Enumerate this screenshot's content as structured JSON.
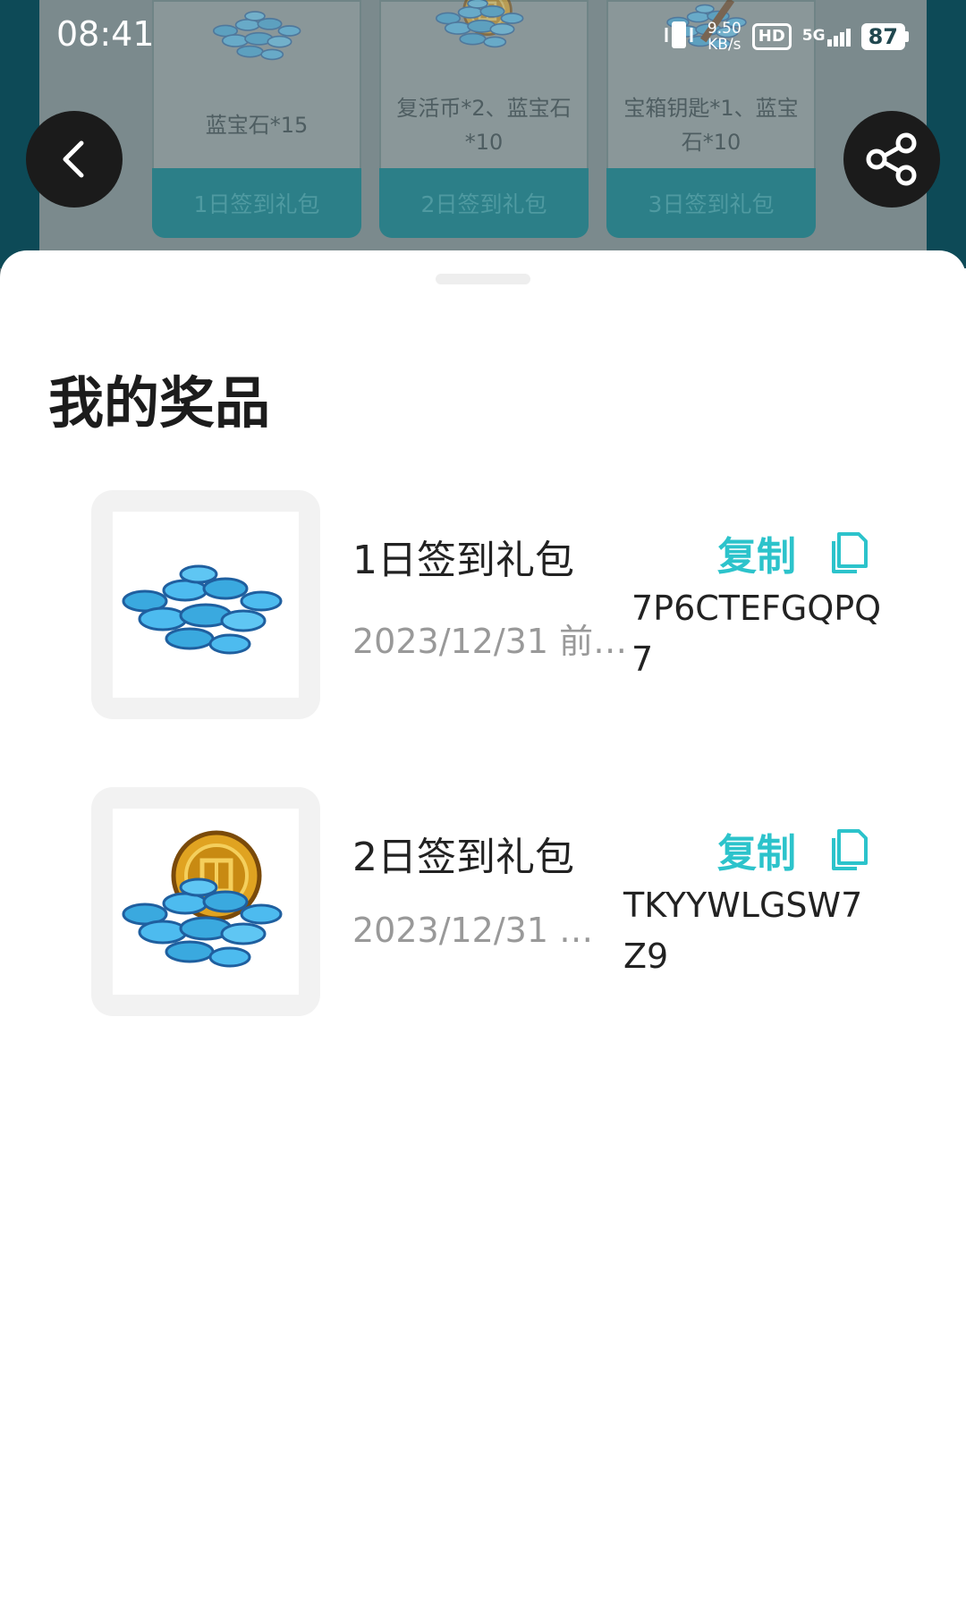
{
  "status_bar": {
    "time": "08:41",
    "net_speed_value": "9.50",
    "net_speed_unit": "KB/s",
    "hd_label": "HD",
    "network_label": "5G",
    "battery": "87"
  },
  "background": {
    "gift_cards": [
      {
        "description": "蓝宝石*15",
        "label": "1日签到礼包",
        "icon": "sapphire-pile-icon"
      },
      {
        "description": "复活币*2、蓝宝石*10",
        "label": "2日签到礼包",
        "icon": "revive-coin-sapphire-icon"
      },
      {
        "description": "宝箱钥匙*1、蓝宝石*10",
        "label": "3日签到礼包",
        "icon": "chest-key-sapphire-icon"
      }
    ]
  },
  "sheet": {
    "title": "我的奖品",
    "prizes": [
      {
        "name": "1日签到礼包",
        "date": "2023/12/31 前…",
        "copy_label": "复制",
        "code": "7P6CTEFGQPQ7",
        "icon": "sapphire-pile-icon"
      },
      {
        "name": "2日签到礼包",
        "date": "2023/12/31 …",
        "copy_label": "复制",
        "code": "TKYYWLGSW7Z9",
        "icon": "revive-coin-sapphire-icon"
      }
    ]
  },
  "colors": {
    "accent": "#2cc3cb",
    "background_teal": "#0d4a57",
    "dim_overlay": "#7b8a8d",
    "text_primary": "#222222",
    "text_secondary": "#999999"
  }
}
